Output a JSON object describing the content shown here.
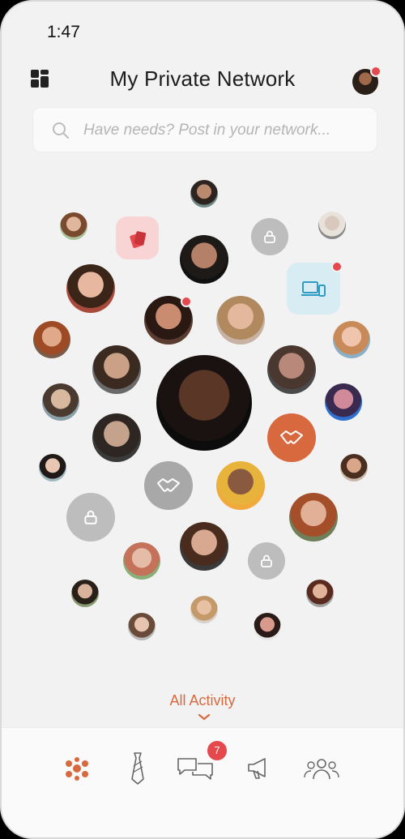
{
  "status": {
    "time": "1:47"
  },
  "header": {
    "title": "My Private Network"
  },
  "search": {
    "placeholder": "Have needs? Post in your network..."
  },
  "activity": {
    "label": "All Activity"
  },
  "tabbar": {
    "messages_badge": "7"
  },
  "colors": {
    "accent": "#d8693f",
    "badge": "#e5484d",
    "lock": "#bdbdbd",
    "handshake_active": "#d8693f",
    "handshake_inactive": "#a8a8a8"
  }
}
